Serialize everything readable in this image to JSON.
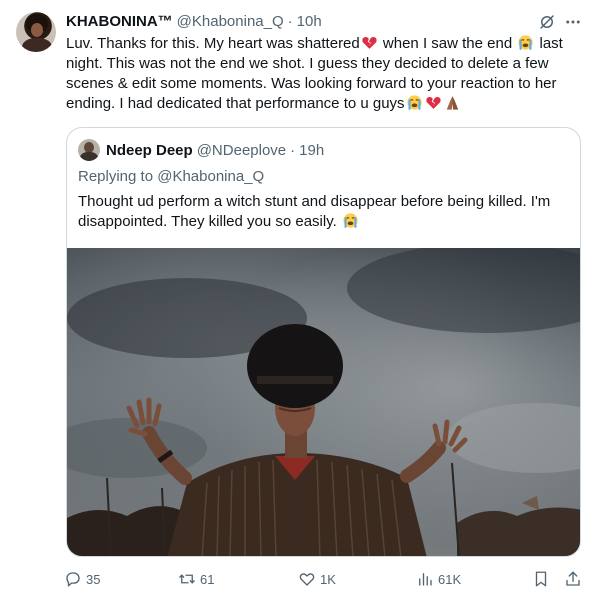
{
  "tweet": {
    "author_name": "KHABONINA™",
    "author_handle": "@Khabonina_Q",
    "separator": "·",
    "time": "10h",
    "text_parts": [
      "Luv. Thanks for this. My heart was shattered",
      " when I saw the end ",
      " last night. This was not the end we shot. I guess they decided to delete a few scenes & edit some moments. Was looking forward to your reaction to her ending. I had dedicated that performance to u guys"
    ],
    "icons": {
      "grok": "grok-icon",
      "more": "more-icon"
    }
  },
  "quote": {
    "author_name": "Ndeep Deep",
    "author_handle": "@NDeeplove",
    "separator": "·",
    "time": "19h",
    "replying_prefix": "Replying to",
    "replying_to": "@Khabonina_Q",
    "text": "Thought ud perform a witch stunt and disappear before being killed. I'm disappointed. They killed you so easily."
  },
  "actions": {
    "replies": "35",
    "reposts": "61",
    "likes": "1K",
    "views": "61K"
  },
  "colors": {
    "text": "#0f1419",
    "secondary": "#536471",
    "border": "#cfd9de"
  }
}
